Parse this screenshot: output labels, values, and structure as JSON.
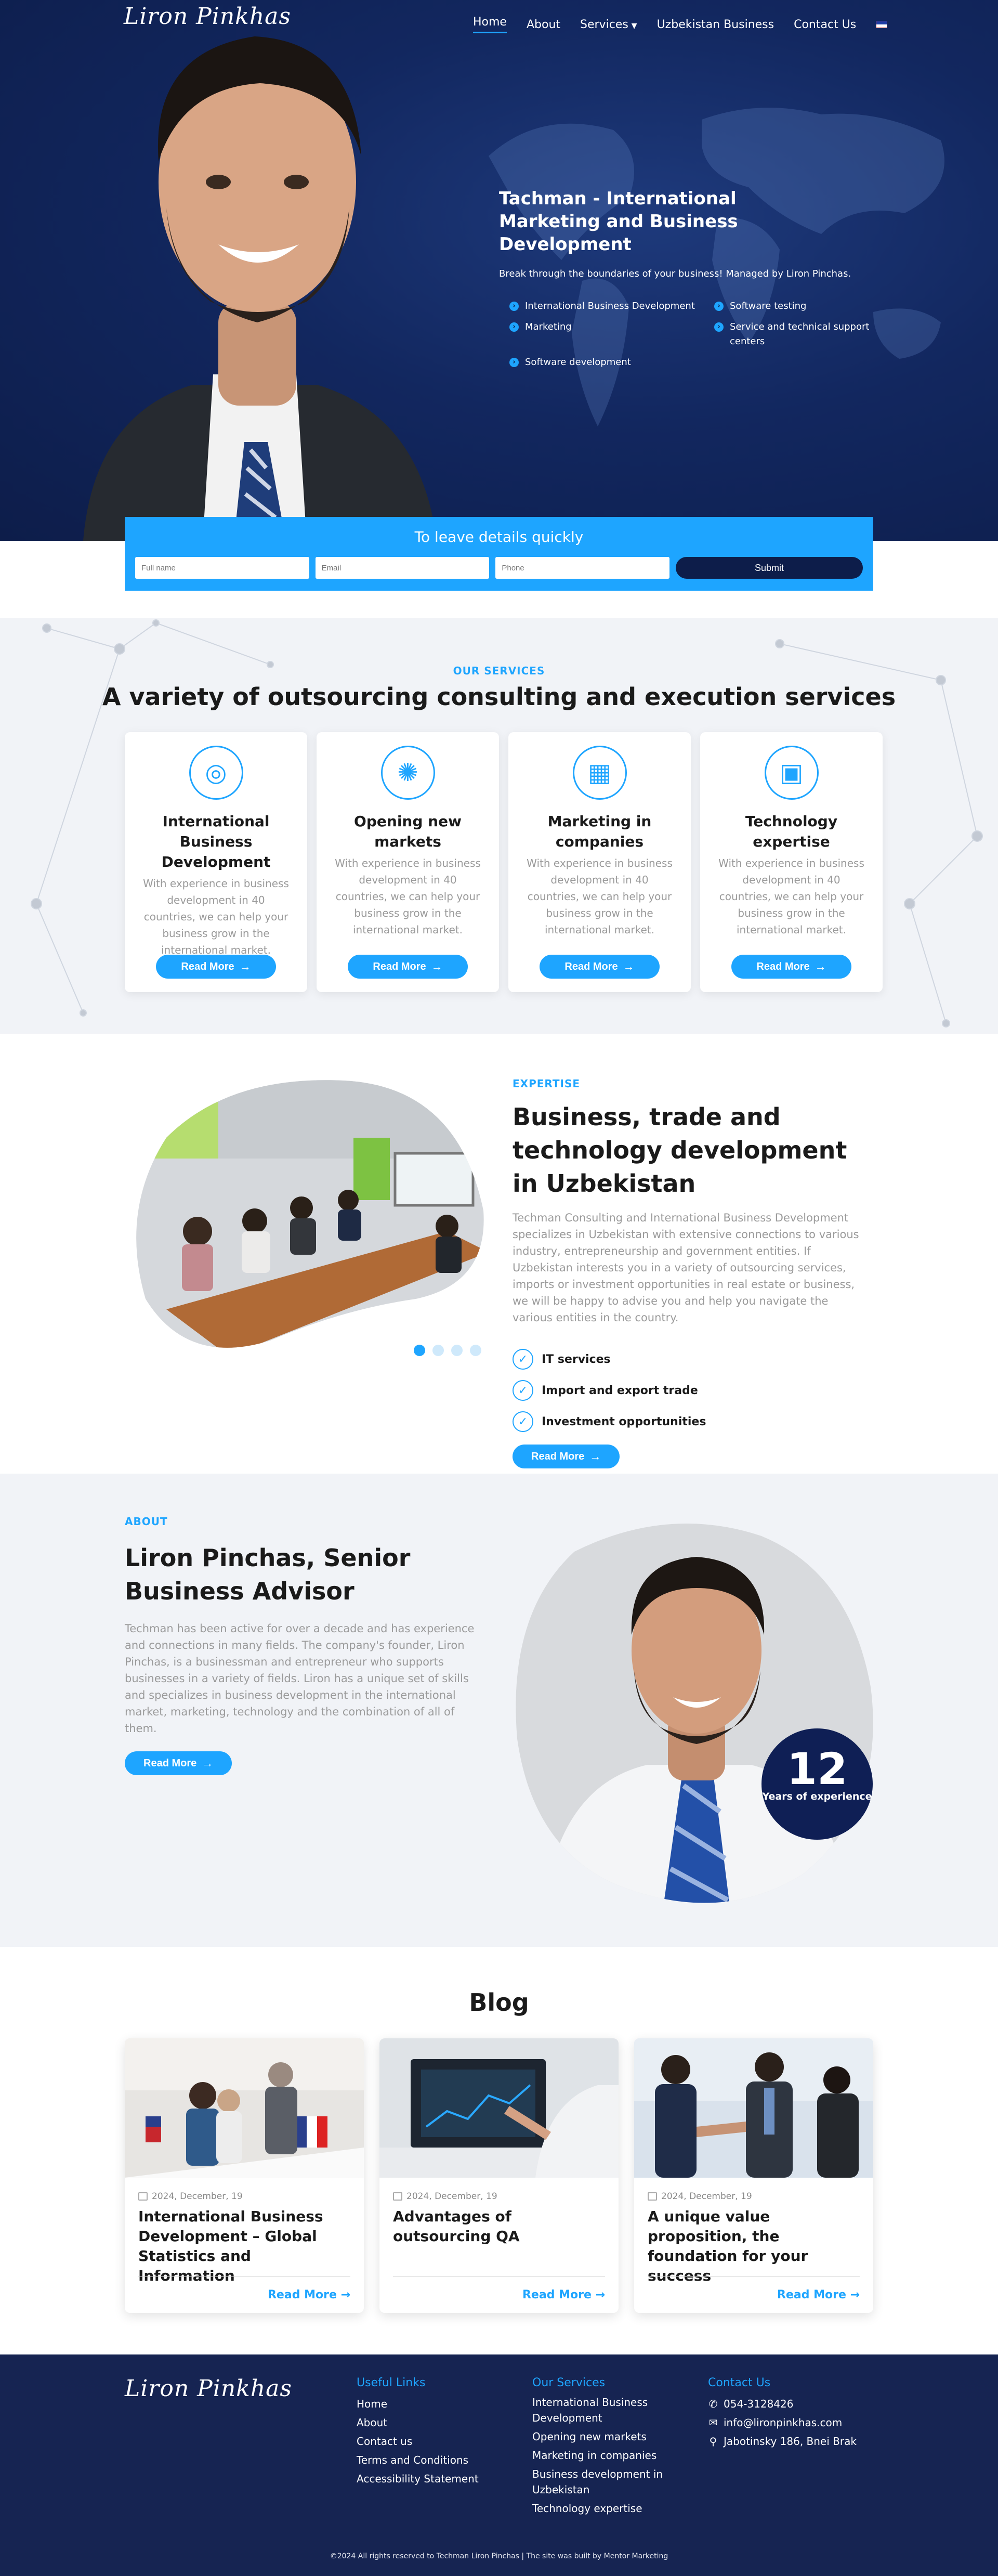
{
  "brand": {
    "logo_text": "Liron Pinkhas"
  },
  "nav": {
    "items": [
      "Home",
      "About",
      "Services",
      "Uzbekistan Business",
      "Contact Us"
    ],
    "active": "Home",
    "language_icon": "us-flag-icon"
  },
  "hero": {
    "title": "Tachman - International Marketing and Business Development",
    "subtitle": "Break through the boundaries of your business! Managed by Liron Pinchas.",
    "list": [
      "International Business Development",
      "Software testing",
      "Marketing",
      "Service and technical support centers",
      "Software development"
    ]
  },
  "lead_form": {
    "title": "To leave details quickly",
    "placeholders": {
      "name": "Full name",
      "email": "Email",
      "phone": "Phone"
    },
    "submit": "Submit"
  },
  "services": {
    "kicker": "OUR SERVICES",
    "title": "A variety of outsourcing consulting and execution services",
    "cards": [
      {
        "icon": "globe-icon",
        "title": "International Business Development",
        "text": "With experience in business development in 40 countries, we can help your business grow in the international market.",
        "button": "Read More"
      },
      {
        "icon": "lightbulb-icon",
        "title": "Opening new markets",
        "text": "With experience in business development in 40 countries, we can help your business grow in the international market.",
        "button": "Read More"
      },
      {
        "icon": "building-location-icon",
        "title": "Marketing in companies",
        "text": "With experience in business development in 40 countries, we can help your business grow in the international market.",
        "button": "Read More"
      },
      {
        "icon": "chip-icon",
        "title": "Technology expertise",
        "text": "With experience in business development in 40 countries, we can help your business grow in the international market.",
        "button": "Read More"
      }
    ]
  },
  "expertise": {
    "kicker": "EXPERTISE",
    "title": "Business, trade and technology development in Uzbekistan",
    "text": "Techman Consulting and International Business Development specializes in Uzbekistan with extensive connections to various industry, entrepreneurship and government entities. If Uzbekistan interests you in a variety of outsourcing services, imports or investment opportunities in real estate or business, we will be happy to advise you and help you navigate the various entities in the country.",
    "checks": [
      "IT services",
      "Import and export trade",
      "Investment opportunities"
    ],
    "button": "Read More",
    "slider_dots": 4
  },
  "about": {
    "kicker": "ABOUT",
    "title": "Liron Pinchas, Senior Business Advisor",
    "text": "Techman has been active for over a decade and has experience and connections in many fields. The company's founder, Liron Pinchas, is a businessman and entrepreneur who supports businesses in a variety of fields. Liron has a unique set of skills and specializes in business development in the international market, marketing, technology and the combination of all of them.",
    "button": "Read More",
    "years_number": "12",
    "years_label": "Years of experience"
  },
  "blog": {
    "title": "Blog",
    "posts": [
      {
        "date": "2024, December, 19",
        "title": "International Business Development – Global Statistics and Information",
        "link": "Read More"
      },
      {
        "date": "2024, December, 19",
        "title": "Advantages of outsourcing QA",
        "link": "Read More"
      },
      {
        "date": "2024, December, 19",
        "title": "A unique value proposition, the foundation for your success",
        "link": "Read More"
      }
    ]
  },
  "footer": {
    "useful_title": "Useful Links",
    "useful": [
      "Home",
      "About",
      "Contact us",
      "Terms and Conditions",
      "Accessibility Statement"
    ],
    "services_title": "Our Services",
    "services": [
      "International Business Development",
      "Opening new markets",
      "Marketing in companies",
      "Business development in Uzbekistan",
      "Technology expertise"
    ],
    "contact_title": "Contact Us",
    "phone": "054-3128426",
    "email": "info@lironpinkhas.com",
    "address": "Jabotinsky 186, Bnei Brak",
    "copyright": "©2024 All rights reserved to Techman Liron Pinchas | The site was built by Mentor Marketing"
  },
  "colors": {
    "accent": "#1ea5ff",
    "navy": "#0d1d4a",
    "footer": "#162452",
    "light_bg": "#f1f3f7"
  }
}
